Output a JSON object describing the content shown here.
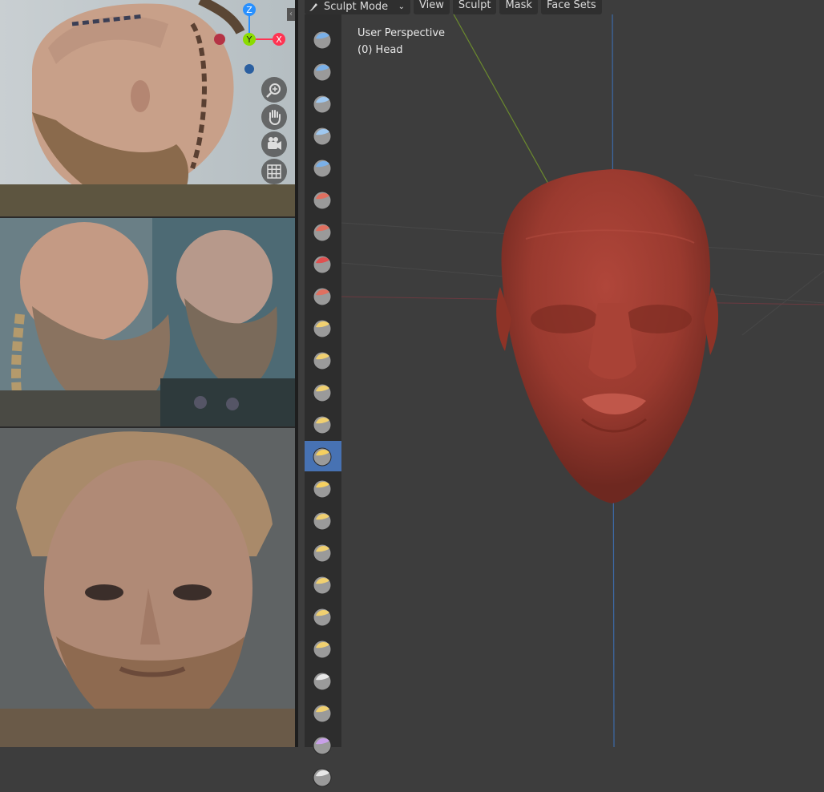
{
  "header": {
    "mode": "Sculpt Mode",
    "menus": [
      "View",
      "Sculpt",
      "Mask",
      "Face Sets"
    ]
  },
  "viewport": {
    "perspective": "User Perspective",
    "object": "(0) Head"
  },
  "gizmo": {
    "z": "Z",
    "y": "Y",
    "x": "X"
  },
  "toolbar": {
    "active_index": 13,
    "tools": [
      "draw-sharp-icon",
      "clay-icon",
      "clay-strips-icon",
      "clay-thumb-icon",
      "layer-icon",
      "inflate-icon",
      "blob-icon",
      "crease-icon",
      "smooth-icon",
      "flatten-icon",
      "fill-icon",
      "scrape-icon",
      "multiplane-scrape-icon",
      "pinch-icon",
      "grab-icon",
      "elastic-deform-icon",
      "snake-hook-icon",
      "thumb-icon",
      "pose-icon",
      "nudge-icon",
      "rotate-icon",
      "slide-relax-icon",
      "boundary-icon",
      "cloth-icon"
    ]
  },
  "colors": {
    "active_tool": "#4772b3",
    "mesh": "#9e3a2e",
    "axis_x": "#ff3352",
    "axis_y": "#8bdc00",
    "axis_z": "#2890ff"
  }
}
